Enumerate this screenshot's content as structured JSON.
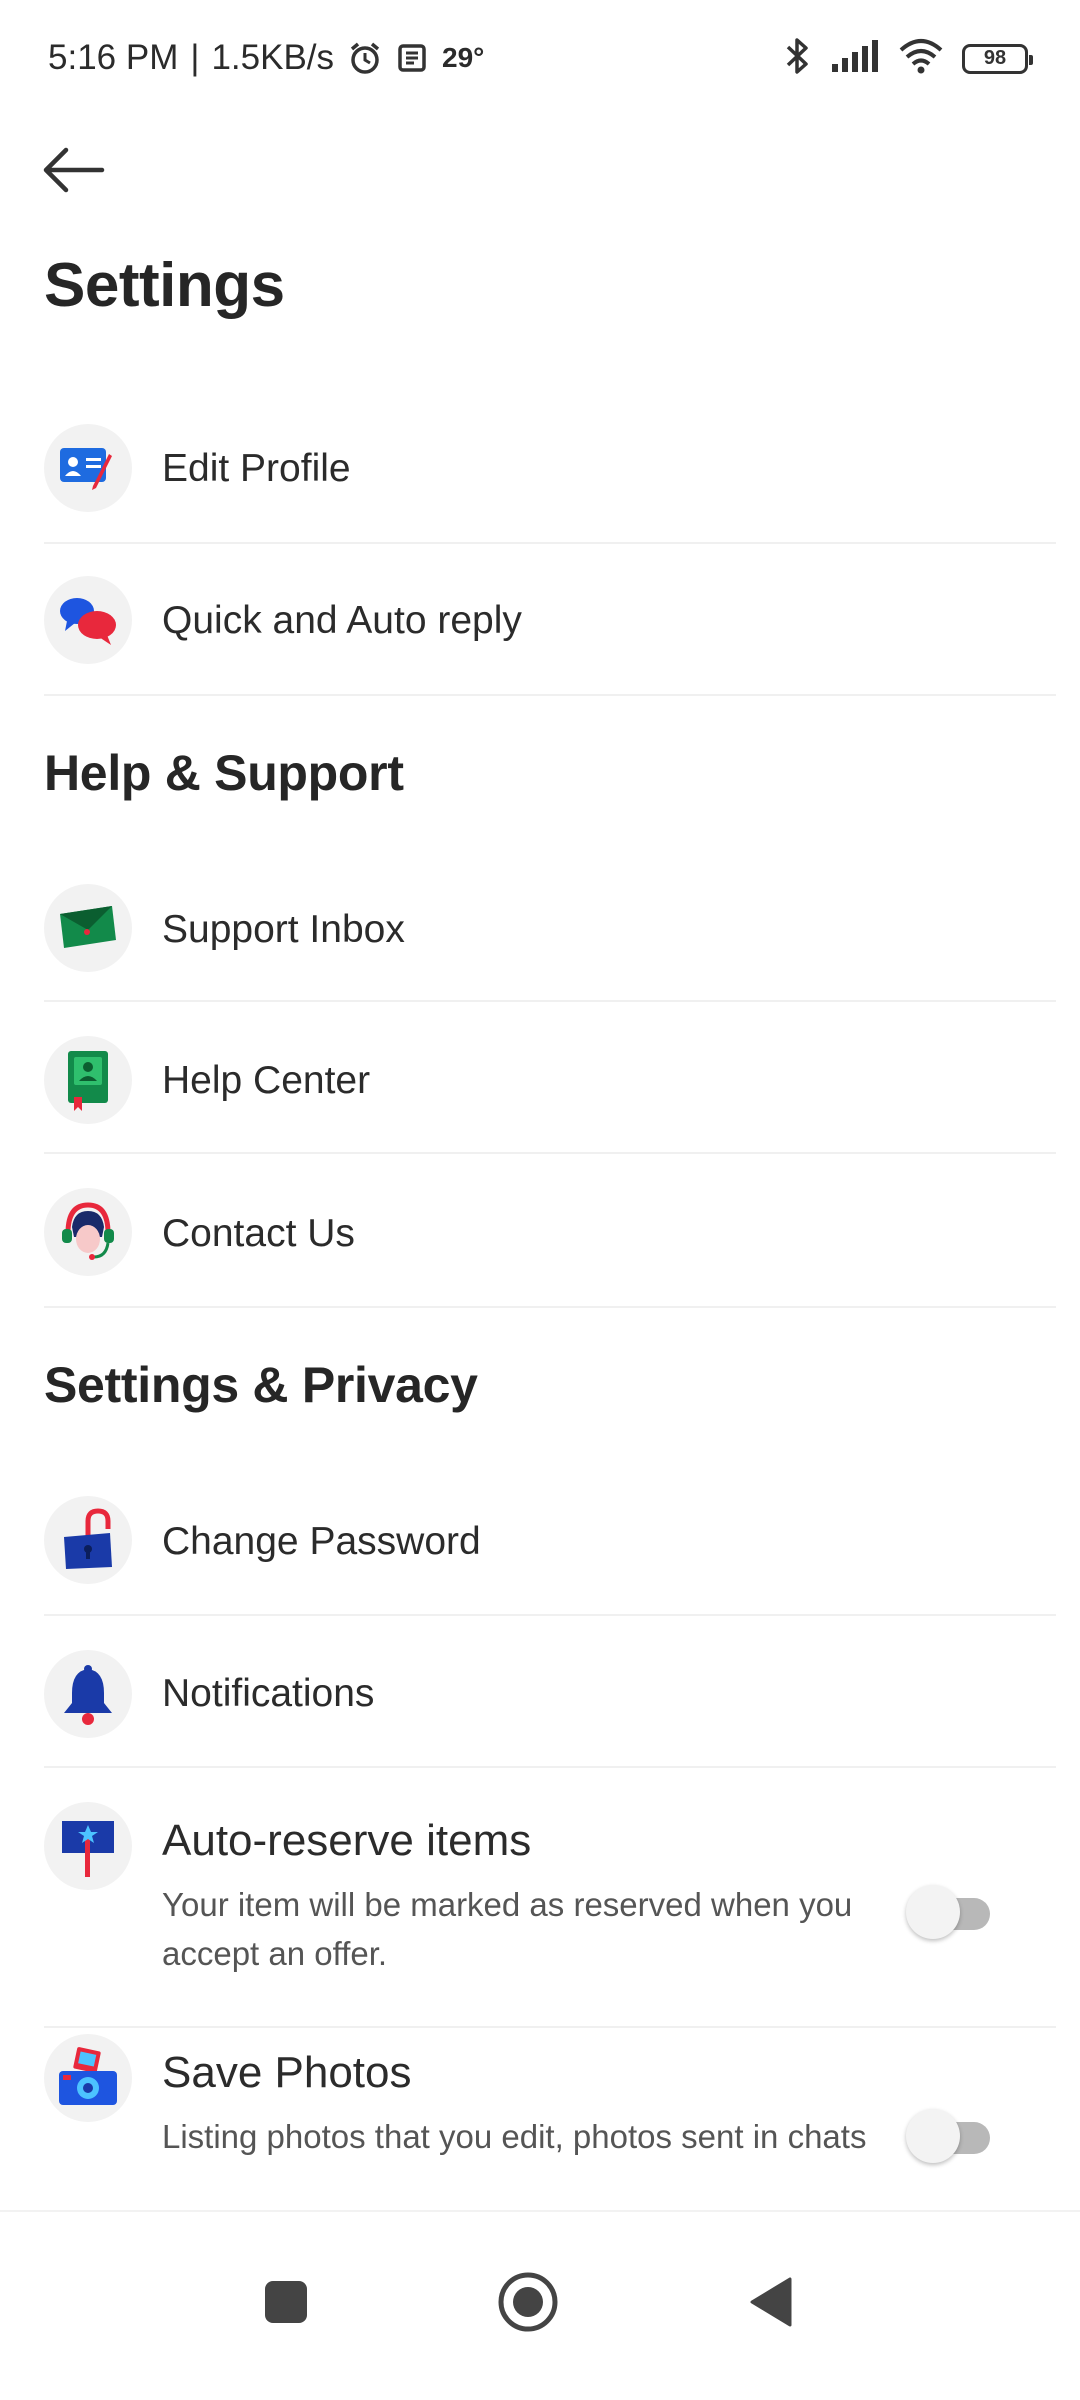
{
  "status_bar": {
    "time": "5:16 PM",
    "speed": "1.5KB/s",
    "temperature": "29°",
    "battery": "98",
    "icons": [
      "alarm-icon",
      "news-icon",
      "bluetooth-icon",
      "signal-icon",
      "wifi-icon",
      "battery-icon"
    ]
  },
  "header": {
    "title": "Settings"
  },
  "sections": {
    "help_title": "Help & Support",
    "privacy_title": "Settings & Privacy"
  },
  "items": {
    "edit_profile": "Edit Profile",
    "quick_reply": "Quick and Auto reply",
    "support_inbox": "Support Inbox",
    "help_center": "Help Center",
    "contact_us": "Contact Us",
    "change_password": "Change Password",
    "notifications": "Notifications",
    "auto_reserve": {
      "label": "Auto-reserve items",
      "description": "Your item will be marked as reserved when you accept an offer.",
      "enabled": false
    },
    "save_photos": {
      "label": "Save Photos",
      "description": "Listing photos that you edit, photos sent in chats",
      "enabled": false
    }
  },
  "colors": {
    "blue": "#1e55e0",
    "red": "#e8283c",
    "green": "#128a4a",
    "navy": "#1a3aa8"
  }
}
